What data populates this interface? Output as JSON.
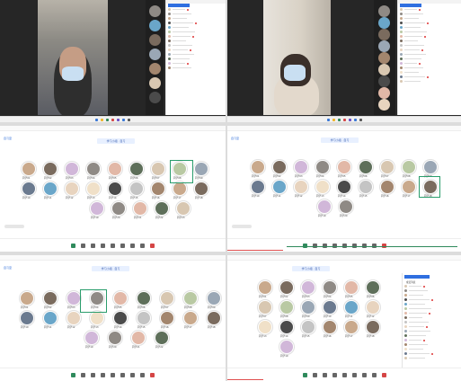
{
  "panels": {
    "p1": {
      "sidebar_title": "好友列表",
      "sidebar_rows": 14,
      "thumbs": 7
    },
    "p2": {
      "sidebar_title": "好友列表",
      "sidebar_rows": 17,
      "thumbs": 9
    },
    "p3": {
      "room_title": "学习小组 · 自习",
      "corner_label": "自习室",
      "avatars": [
        "同学01",
        "同学02",
        "同学03",
        "同学04",
        "同学05",
        "同学06",
        "同学07",
        "同学08",
        "同学09",
        "同学10",
        "同学11",
        "同学12",
        "同学13",
        "同学14",
        "同学15",
        "同学16",
        "同学17",
        "同学18",
        "同学19",
        "同学20",
        "同学21",
        "同学22",
        "同学23"
      ]
    },
    "p4": {
      "room_title": "学习小组 · 自习",
      "corner_label": "自习室",
      "avatars": [
        "同学01",
        "同学02",
        "同学03",
        "同学04",
        "同学05",
        "同学06",
        "同学07",
        "同学08",
        "同学09",
        "同学10",
        "同学11",
        "同学12",
        "同学13",
        "同学14",
        "同学15",
        "同学16",
        "同学17",
        "同学18",
        "同学19",
        "同学20"
      ]
    },
    "p5": {
      "room_title": "学习小组 · 自习",
      "corner_label": "自习室",
      "avatars": [
        "同学01",
        "同学02",
        "同学03",
        "同学04",
        "同学05",
        "同学06",
        "同学07",
        "同学08",
        "同学09",
        "同学10",
        "同学11",
        "同学12",
        "同学13",
        "同学14",
        "同学15",
        "同学16",
        "同学17",
        "同学18",
        "同学19",
        "同学20",
        "同学21",
        "同学22"
      ]
    },
    "p6": {
      "room_title": "学习小组 · 自习",
      "sidebar_title": "成员列表",
      "avatars": [
        "同学01",
        "同学02",
        "同学03",
        "同学04",
        "同学05",
        "同学06",
        "同学07",
        "同学08",
        "同学09",
        "同学10",
        "同学11",
        "同学12",
        "同学13",
        "同学14",
        "同学15",
        "同学16",
        "同学17",
        "同学18",
        "同学19"
      ]
    }
  },
  "colors": {
    "accent": "#2f6fe0",
    "select": "#2a9d6c",
    "danger": "#d54545"
  }
}
